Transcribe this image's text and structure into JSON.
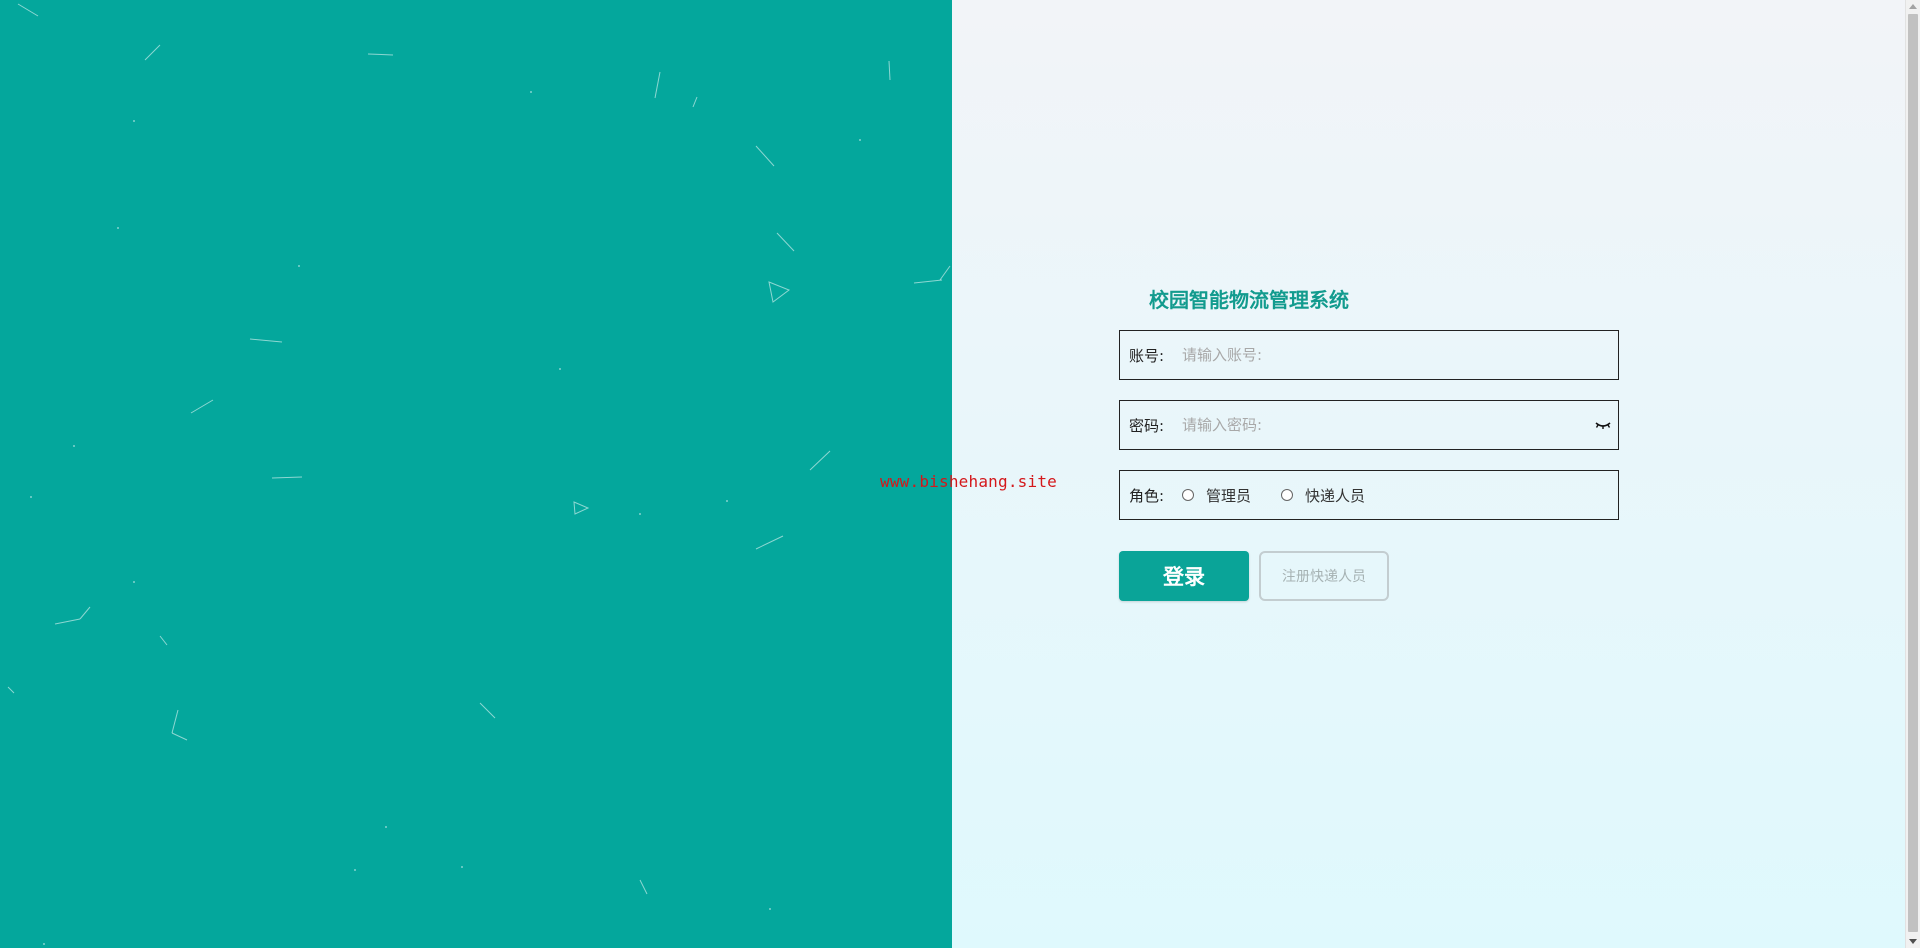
{
  "colors": {
    "left_panel_bg": "#04a79c",
    "accent": "#0aa498",
    "title_color": "#129b8e",
    "watermark_color": "#d4181b"
  },
  "watermark": "www.bishehang.site",
  "login": {
    "title": "校园智能物流管理系统",
    "account": {
      "label": "账号:",
      "placeholder": "请输入账号:",
      "value": ""
    },
    "password": {
      "label": "密码:",
      "placeholder": "请输入密码:",
      "value": "",
      "toggle_icon": "eye-closed-icon"
    },
    "role": {
      "label": "角色:",
      "options": [
        "管理员",
        "快递人员"
      ],
      "selected": null
    },
    "login_button": "登录",
    "register_button": "注册快递人员"
  }
}
